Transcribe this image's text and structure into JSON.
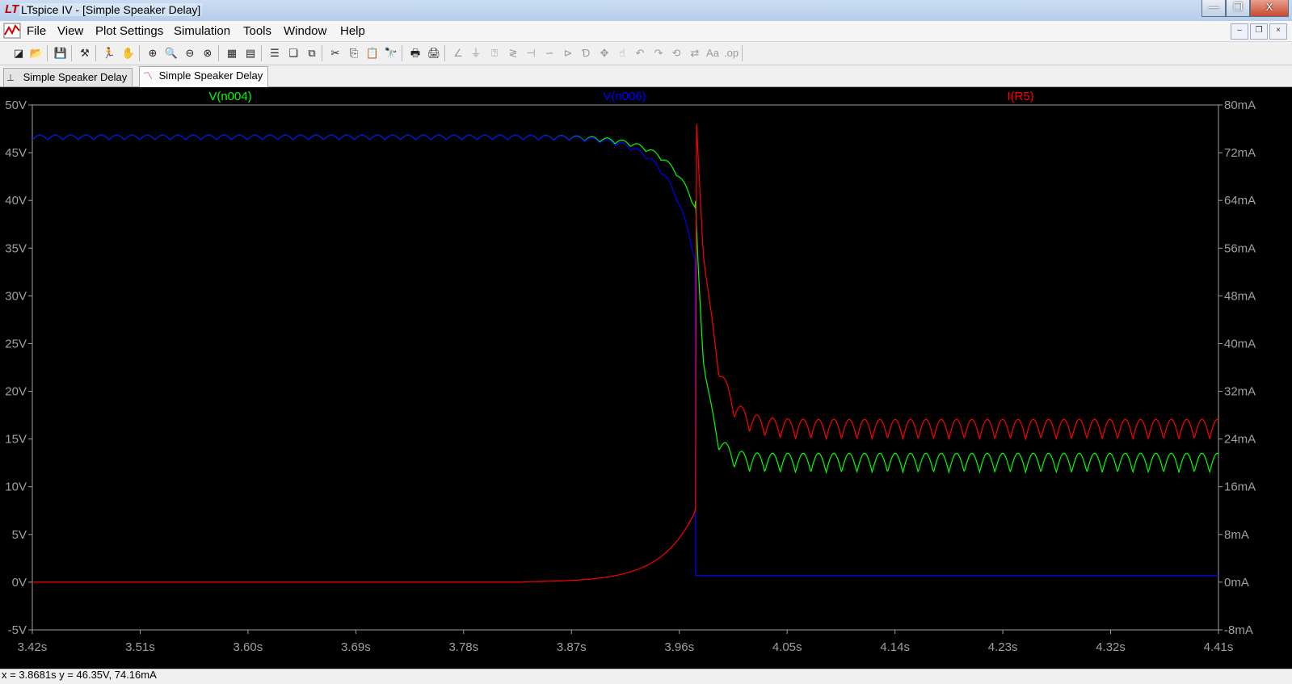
{
  "window": {
    "title": "LTspice IV - [Simple Speaker Delay]",
    "app_icon": "ltspice-logo-icon",
    "controls": {
      "minimize": "—",
      "maximize": "❐",
      "close": "X"
    }
  },
  "menubar": {
    "icon": "waveform-icon",
    "items": [
      "File",
      "View",
      "Plot Settings",
      "Simulation",
      "Tools",
      "Window",
      "Help"
    ],
    "mdi_controls": [
      "–",
      "❐",
      "×"
    ]
  },
  "toolbar": {
    "buttons": [
      {
        "name": "new-schematic-icon",
        "glyph": "◪"
      },
      {
        "name": "open-icon",
        "glyph": "📂"
      },
      {
        "name": "save-icon",
        "glyph": "💾"
      },
      {
        "name": "control-panel-icon",
        "glyph": "⚒"
      },
      {
        "name": "run-icon",
        "glyph": "🏃"
      },
      {
        "name": "halt-icon",
        "glyph": "✋"
      },
      {
        "name": "zoom-in-icon",
        "glyph": "⊕"
      },
      {
        "name": "zoom-area-icon",
        "glyph": "🔍"
      },
      {
        "name": "zoom-out-icon",
        "glyph": "⊖"
      },
      {
        "name": "zoom-cancel-icon",
        "glyph": "⊗"
      },
      {
        "name": "autorange-icon",
        "glyph": "▦"
      },
      {
        "name": "fit-icon",
        "glyph": "▤"
      },
      {
        "name": "tile-horizontal-icon",
        "glyph": "☰"
      },
      {
        "name": "cascade-icon",
        "glyph": "❏"
      },
      {
        "name": "tile-vertical-icon",
        "glyph": "⧉"
      },
      {
        "name": "cut-icon",
        "glyph": "✂"
      },
      {
        "name": "copy-icon",
        "glyph": "⎘"
      },
      {
        "name": "paste-icon",
        "glyph": "📋"
      },
      {
        "name": "find-icon",
        "glyph": "🔭"
      },
      {
        "name": "print-icon",
        "glyph": "🖶"
      },
      {
        "name": "print-preview-icon",
        "glyph": "🖨"
      },
      {
        "name": "draw-wire-icon",
        "glyph": "∠"
      },
      {
        "name": "ground-icon",
        "glyph": "⏚"
      },
      {
        "name": "label-net-icon",
        "glyph": "⍰"
      },
      {
        "name": "resistor-icon",
        "glyph": "≷"
      },
      {
        "name": "capacitor-icon",
        "glyph": "⊣"
      },
      {
        "name": "inductor-icon",
        "glyph": "∽"
      },
      {
        "name": "diode-icon",
        "glyph": "⊳"
      },
      {
        "name": "component-icon",
        "glyph": "Ɗ"
      },
      {
        "name": "move-icon",
        "glyph": "✥"
      },
      {
        "name": "drag-icon",
        "glyph": "☝"
      },
      {
        "name": "undo-icon",
        "glyph": "↶"
      },
      {
        "name": "redo-icon",
        "glyph": "↷"
      },
      {
        "name": "rotate-icon",
        "glyph": "⟲"
      },
      {
        "name": "mirror-icon",
        "glyph": "⇄"
      },
      {
        "name": "text-icon",
        "glyph": "Aa"
      },
      {
        "name": "spice-directive-icon",
        "glyph": ".op"
      }
    ]
  },
  "tabs": [
    {
      "label": "Simple Speaker Delay",
      "icon": "schematic-icon",
      "active": false
    },
    {
      "label": "Simple Speaker Delay",
      "icon": "waveform-icon",
      "active": true
    }
  ],
  "chart_data": {
    "type": "line",
    "background": "#000000",
    "xlim": [
      3.42,
      4.41
    ],
    "ylim_left": [
      -5,
      50
    ],
    "ylim_right": [
      -8,
      80
    ],
    "x_ticks": [
      "3.42s",
      "3.51s",
      "3.60s",
      "3.69s",
      "3.78s",
      "3.87s",
      "3.96s",
      "4.05s",
      "4.14s",
      "4.23s",
      "4.32s",
      "4.41s"
    ],
    "y_ticks_left": [
      "50V",
      "45V",
      "40V",
      "35V",
      "30V",
      "25V",
      "20V",
      "15V",
      "10V",
      "5V",
      "0V",
      "-5V"
    ],
    "y_ticks_right": [
      "80mA",
      "72mA",
      "64mA",
      "56mA",
      "48mA",
      "40mA",
      "32mA",
      "24mA",
      "16mA",
      "8mA",
      "0mA",
      "-8mA"
    ],
    "series": [
      {
        "name": "V(n004)",
        "color": "#00ff00",
        "axis": "left"
      },
      {
        "name": "V(n006)",
        "color": "#0000ff",
        "axis": "left"
      },
      {
        "name": "I(R5)",
        "color": "#ff0000",
        "axis": "right"
      }
    ]
  },
  "status": {
    "readout": "x = 3.8681s    y = 46.35V, 74.16mA"
  }
}
